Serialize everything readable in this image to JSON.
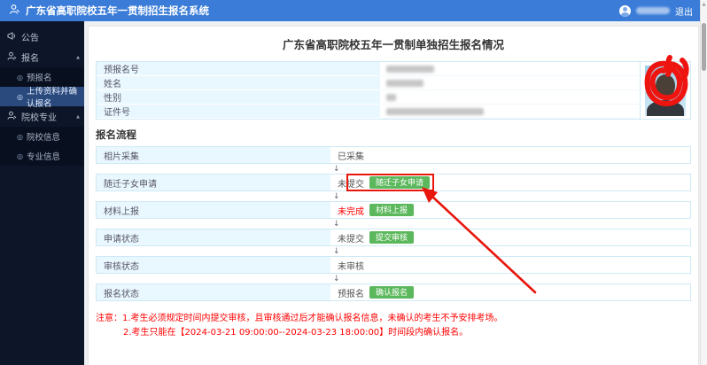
{
  "header": {
    "app_title": "广东省高职院校五年一贯制招生报名系统",
    "logout_label": "退出",
    "username_masked": true
  },
  "sidebar": {
    "items": [
      {
        "label": "公告"
      },
      {
        "label": "报名",
        "expanded": true,
        "children": [
          {
            "label": "预报名"
          },
          {
            "label": "上传资料并确认报名",
            "active": true
          }
        ]
      },
      {
        "label": "院校专业",
        "expanded": true,
        "children": [
          {
            "label": "院校信息"
          },
          {
            "label": "专业信息"
          }
        ]
      }
    ]
  },
  "main": {
    "page_title": "广东省高职院校五年一贯制单独招生报名情况",
    "info_table": {
      "rows": [
        {
          "label": "预报名号",
          "value_masked": true
        },
        {
          "label": "姓名",
          "value_masked": true
        },
        {
          "label": "性别",
          "value_masked": true
        },
        {
          "label": "证件号",
          "value_masked": true
        }
      ],
      "photo": "考生证件照（面部被红色涂抹遮挡）"
    },
    "process": {
      "section_title": "报名流程",
      "flow_arrow": "↓",
      "rows": [
        {
          "label": "相片采集",
          "status": "已采集"
        },
        {
          "label": "随迁子女申请",
          "status": "未提交",
          "button": "随迁子女申请",
          "annotated": true
        },
        {
          "label": "材料上报",
          "status": "未完成",
          "status_color": "#ff0000",
          "button": "材料上报"
        },
        {
          "label": "申请状态",
          "status": "未提交",
          "button": "提交审核"
        },
        {
          "label": "审核状态",
          "status": "未审核"
        },
        {
          "label": "报名状态",
          "status": "预报名",
          "button": "确认报名"
        }
      ]
    },
    "notes": {
      "line1": "注意：1.考生必须规定时间内提交审核，且审核通过后才能确认报名信息，未确认的考生不予安排考场。",
      "line2": "2.考生只能在【2024-03-21 09:00:00--2024-03-23 18:00:00】时间段内确认报名。"
    }
  },
  "glyphs": {
    "caret_expanded": "▲",
    "sub_bullet": "◎",
    "scroll_up_arrow": "▲"
  },
  "colors": {
    "header_bg": "#3a7cd8",
    "sidebar_bg": "#0d1628",
    "sidebar_active_bg": "#2a4a7d",
    "label_cell_bg": "#e9f7fe",
    "table_border": "#cfe9f6",
    "button_green": "#5cb85c",
    "status_red": "#ff0000",
    "note_red": "#ff0000",
    "annotation_red": "#e8160c"
  }
}
